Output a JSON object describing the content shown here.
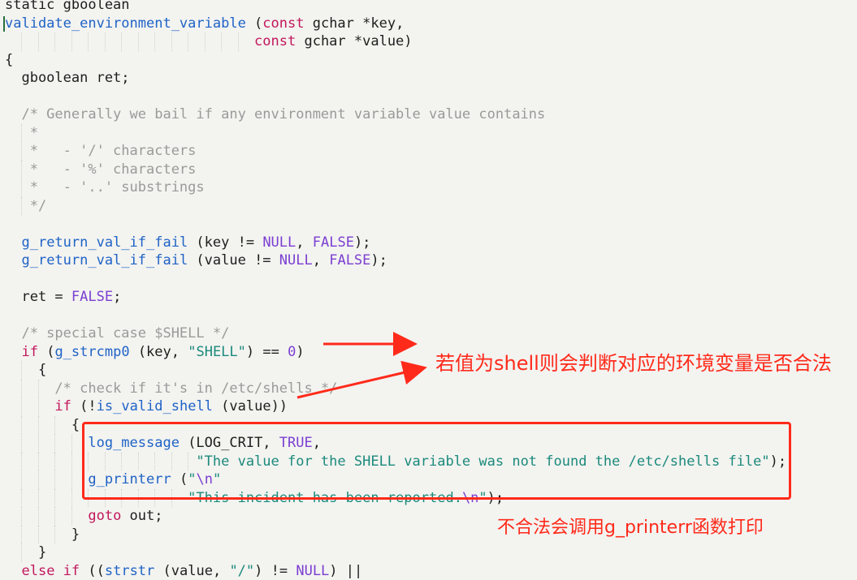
{
  "editor": {
    "language": "C",
    "colors": {
      "background": "#f3f3f0",
      "keyword": "#c2185b",
      "constant": "#7b3fd1",
      "function": "#1f63c6",
      "string": "#1b8a7b",
      "comment": "#9a9a9a",
      "plain": "#1e1e1e",
      "annotation": "#ff2a1a"
    },
    "lines": [
      {
        "id": "l0",
        "tokens": [
          {
            "t": "static gboolean",
            "c": "plain"
          }
        ]
      },
      {
        "id": "l1",
        "tokens": [
          {
            "t": "validate_environment_variable",
            "c": "fn"
          },
          {
            "t": " (",
            "c": "plain"
          },
          {
            "t": "const",
            "c": "kw"
          },
          {
            "t": " gchar *key,",
            "c": "plain"
          }
        ]
      },
      {
        "id": "l2",
        "tokens": [
          {
            "t": "                              ",
            "c": "plain"
          },
          {
            "t": "const",
            "c": "kw"
          },
          {
            "t": " gchar *value)",
            "c": "plain"
          }
        ]
      },
      {
        "id": "l3",
        "tokens": [
          {
            "t": "{",
            "c": "plain"
          }
        ]
      },
      {
        "id": "l4",
        "tokens": [
          {
            "t": "  gboolean ret;",
            "c": "plain"
          }
        ]
      },
      {
        "id": "l5",
        "tokens": []
      },
      {
        "id": "l6",
        "tokens": [
          {
            "t": "  /* Generally we bail if any environment variable value contains",
            "c": "cmt"
          }
        ]
      },
      {
        "id": "l7",
        "tokens": [
          {
            "t": "   *",
            "c": "cmt"
          }
        ]
      },
      {
        "id": "l8",
        "tokens": [
          {
            "t": "   *   - '/' characters",
            "c": "cmt"
          }
        ]
      },
      {
        "id": "l9",
        "tokens": [
          {
            "t": "   *   - '%' characters",
            "c": "cmt"
          }
        ]
      },
      {
        "id": "l10",
        "tokens": [
          {
            "t": "   *   - '..' substrings",
            "c": "cmt"
          }
        ]
      },
      {
        "id": "l11",
        "tokens": [
          {
            "t": "   */",
            "c": "cmt"
          }
        ]
      },
      {
        "id": "l12",
        "tokens": []
      },
      {
        "id": "l13",
        "tokens": [
          {
            "t": "  ",
            "c": "plain"
          },
          {
            "t": "g_return_val_if_fail",
            "c": "fn"
          },
          {
            "t": " (key != ",
            "c": "plain"
          },
          {
            "t": "NULL",
            "c": "num"
          },
          {
            "t": ", ",
            "c": "plain"
          },
          {
            "t": "FALSE",
            "c": "num"
          },
          {
            "t": ");",
            "c": "plain"
          }
        ]
      },
      {
        "id": "l14",
        "tokens": [
          {
            "t": "  ",
            "c": "plain"
          },
          {
            "t": "g_return_val_if_fail",
            "c": "fn"
          },
          {
            "t": " (value != ",
            "c": "plain"
          },
          {
            "t": "NULL",
            "c": "num"
          },
          {
            "t": ", ",
            "c": "plain"
          },
          {
            "t": "FALSE",
            "c": "num"
          },
          {
            "t": ");",
            "c": "plain"
          }
        ]
      },
      {
        "id": "l15",
        "tokens": []
      },
      {
        "id": "l16",
        "tokens": [
          {
            "t": "  ret = ",
            "c": "plain"
          },
          {
            "t": "FALSE",
            "c": "num"
          },
          {
            "t": ";",
            "c": "plain"
          }
        ]
      },
      {
        "id": "l17",
        "tokens": []
      },
      {
        "id": "l18",
        "tokens": [
          {
            "t": "  /* special case $SHELL */",
            "c": "cmt"
          }
        ]
      },
      {
        "id": "l19",
        "tokens": [
          {
            "t": "  ",
            "c": "plain"
          },
          {
            "t": "if",
            "c": "kw"
          },
          {
            "t": " (",
            "c": "plain"
          },
          {
            "t": "g_strcmp0",
            "c": "fn"
          },
          {
            "t": " (key, ",
            "c": "plain"
          },
          {
            "t": "\"SHELL\"",
            "c": "str"
          },
          {
            "t": ") == ",
            "c": "plain"
          },
          {
            "t": "0",
            "c": "num"
          },
          {
            "t": ")",
            "c": "plain"
          }
        ]
      },
      {
        "id": "l20",
        "tokens": [
          {
            "t": "    {",
            "c": "plain"
          }
        ]
      },
      {
        "id": "l21",
        "tokens": [
          {
            "t": "      /* check if it's in /etc/shells */",
            "c": "cmt"
          }
        ]
      },
      {
        "id": "l22",
        "tokens": [
          {
            "t": "      ",
            "c": "plain"
          },
          {
            "t": "if",
            "c": "kw"
          },
          {
            "t": " (!",
            "c": "plain"
          },
          {
            "t": "is_valid_shell",
            "c": "fn"
          },
          {
            "t": " (value))",
            "c": "plain"
          }
        ]
      },
      {
        "id": "l23",
        "tokens": [
          {
            "t": "        {",
            "c": "plain"
          }
        ]
      },
      {
        "id": "l24",
        "tokens": [
          {
            "t": "          ",
            "c": "plain"
          },
          {
            "t": "log_message",
            "c": "fn"
          },
          {
            "t": " (LOG_CRIT, ",
            "c": "plain"
          },
          {
            "t": "TRUE",
            "c": "num"
          },
          {
            "t": ",",
            "c": "plain"
          }
        ]
      },
      {
        "id": "l25",
        "tokens": [
          {
            "t": "                       ",
            "c": "plain"
          },
          {
            "t": "\"The value for the SHELL variable was not found the /etc/shells file\"",
            "c": "str"
          },
          {
            "t": ");",
            "c": "plain"
          }
        ]
      },
      {
        "id": "l26",
        "tokens": [
          {
            "t": "          ",
            "c": "plain"
          },
          {
            "t": "g_printerr",
            "c": "fn"
          },
          {
            "t": " (",
            "c": "plain"
          },
          {
            "t": "\"",
            "c": "str"
          },
          {
            "t": "\\n",
            "c": "esc"
          },
          {
            "t": "\"",
            "c": "str"
          }
        ]
      },
      {
        "id": "l27",
        "tokens": [
          {
            "t": "                      ",
            "c": "plain"
          },
          {
            "t": "\"This incident has been reported.",
            "c": "str"
          },
          {
            "t": "\\n",
            "c": "esc"
          },
          {
            "t": "\"",
            "c": "str"
          },
          {
            "t": ");",
            "c": "plain"
          }
        ]
      },
      {
        "id": "l28",
        "tokens": [
          {
            "t": "          ",
            "c": "plain"
          },
          {
            "t": "goto",
            "c": "kw"
          },
          {
            "t": " out;",
            "c": "plain"
          }
        ]
      },
      {
        "id": "l29",
        "tokens": [
          {
            "t": "        }",
            "c": "plain"
          }
        ]
      },
      {
        "id": "l30",
        "tokens": [
          {
            "t": "    }",
            "c": "plain"
          }
        ]
      },
      {
        "id": "l31",
        "tokens": [
          {
            "t": "  ",
            "c": "plain"
          },
          {
            "t": "else if",
            "c": "kw"
          },
          {
            "t": " ((",
            "c": "plain"
          },
          {
            "t": "strstr",
            "c": "fn"
          },
          {
            "t": " (",
            "c": "plain"
          },
          {
            "t": "value",
            "c": "plain"
          },
          {
            "t": ", ",
            "c": "plain"
          },
          {
            "t": "\"/\"",
            "c": "str"
          },
          {
            "t": ") != ",
            "c": "plain"
          },
          {
            "t": "NULL",
            "c": "num"
          },
          {
            "t": ") ||",
            "c": "plain"
          }
        ]
      }
    ]
  },
  "annotations": {
    "shell_note": "若值为shell则会判断对应的环境变量是否合法",
    "printerr_note": "不合法会调用g_printerr函数打印"
  }
}
